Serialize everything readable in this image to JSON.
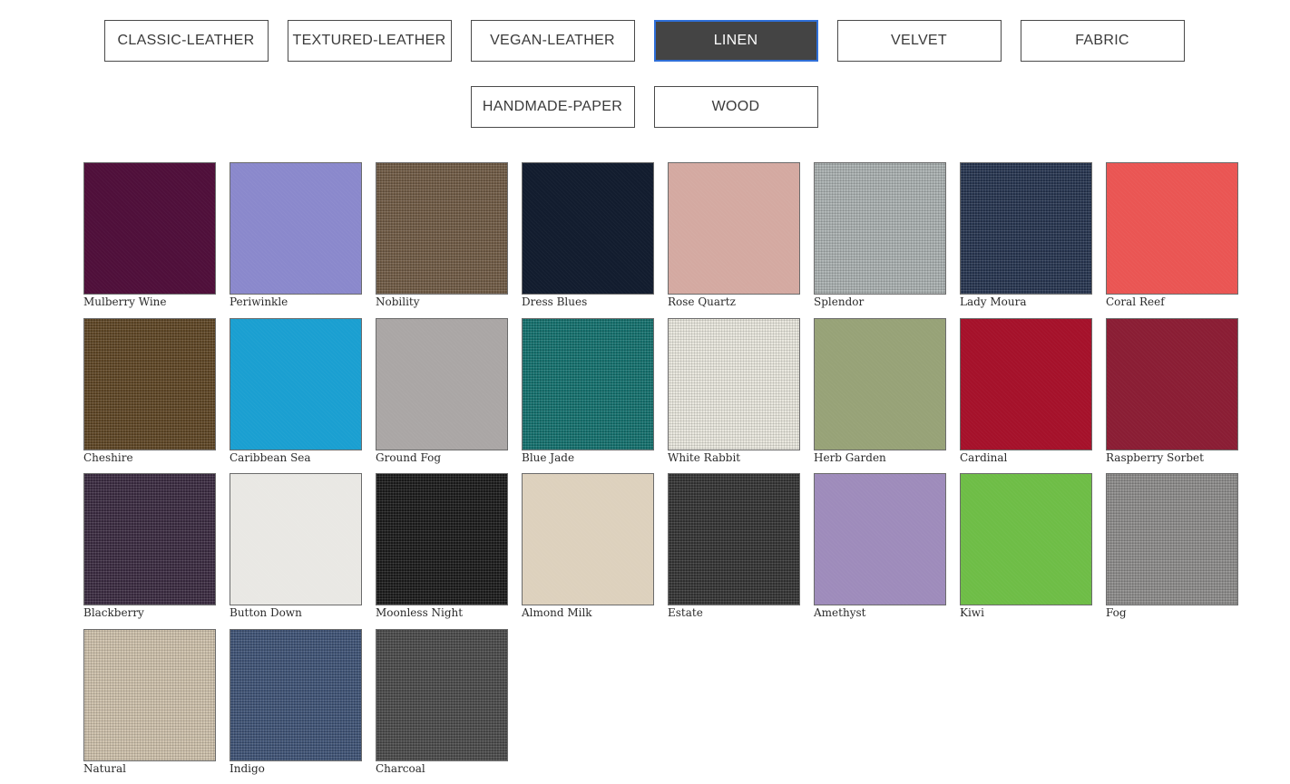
{
  "tabs": [
    {
      "label": "CLASSIC-LEATHER",
      "key": "classic-leather",
      "active": false
    },
    {
      "label": "TEXTURED-LEATHER",
      "key": "textured-leather",
      "active": false
    },
    {
      "label": "VEGAN-LEATHER",
      "key": "vegan-leather",
      "active": false
    },
    {
      "label": "LINEN",
      "key": "linen",
      "active": true
    },
    {
      "label": "VELVET",
      "key": "velvet",
      "active": false
    },
    {
      "label": "FABRIC",
      "key": "fabric",
      "active": false
    },
    {
      "label": "HANDMADE-PAPER",
      "key": "handmade-paper",
      "active": false
    },
    {
      "label": "WOOD",
      "key": "wood",
      "active": false
    }
  ],
  "swatches": [
    {
      "name": "Mulberry Wine",
      "color": "#4f0f3a",
      "texture": "plain"
    },
    {
      "name": "Periwinkle",
      "color": "#8a88cc",
      "texture": "plain"
    },
    {
      "name": "Nobility",
      "color": "#6f5a44",
      "texture": "weave"
    },
    {
      "name": "Dress Blues",
      "color": "#121c2e",
      "texture": "plain"
    },
    {
      "name": "Rose Quartz",
      "color": "#d4a9a1",
      "texture": "plain"
    },
    {
      "name": "Splendor",
      "color": "#a9b0b0",
      "texture": "weave"
    },
    {
      "name": "Lady Moura",
      "color": "#26344f",
      "texture": "weave"
    },
    {
      "name": "Coral Reef",
      "color": "#ea5553",
      "texture": "plain"
    },
    {
      "name": "Cheshire",
      "color": "#5e4524",
      "texture": "weave"
    },
    {
      "name": "Caribbean Sea",
      "color": "#1a9fd1",
      "texture": "plain"
    },
    {
      "name": "Ground Fog",
      "color": "#aaa6a5",
      "texture": "plain"
    },
    {
      "name": "Blue Jade",
      "color": "#13706d",
      "texture": "weave"
    },
    {
      "name": "White Rabbit",
      "color": "#e8e6dc",
      "texture": "weave"
    },
    {
      "name": "Herb Garden",
      "color": "#97a277",
      "texture": "plain"
    },
    {
      "name": "Cardinal",
      "color": "#a5112a",
      "texture": "plain"
    },
    {
      "name": "Raspberry Sorbet",
      "color": "#8a1d34",
      "texture": "plain"
    },
    {
      "name": "Blackberry",
      "color": "#3a2a40",
      "texture": "weave"
    },
    {
      "name": "Button Down",
      "color": "#e9e8e4",
      "texture": "plain"
    },
    {
      "name": "Moonless Night",
      "color": "#1a1a1a",
      "texture": "weave"
    },
    {
      "name": "Almond Milk",
      "color": "#ddd1bd",
      "texture": "plain"
    },
    {
      "name": "Estate",
      "color": "#333333",
      "texture": "weave"
    },
    {
      "name": "Amethyst",
      "color": "#9e8bbb",
      "texture": "plain"
    },
    {
      "name": "Kiwi",
      "color": "#6ebd46",
      "texture": "plain"
    },
    {
      "name": "Fog",
      "color": "#8c8b8a",
      "texture": "weave"
    },
    {
      "name": "Natural",
      "color": "#cdc0aa",
      "texture": "weave"
    },
    {
      "name": "Indigo",
      "color": "#3e5275",
      "texture": "weave"
    },
    {
      "name": "Charcoal",
      "color": "#4a4a4a",
      "texture": "weave"
    }
  ]
}
